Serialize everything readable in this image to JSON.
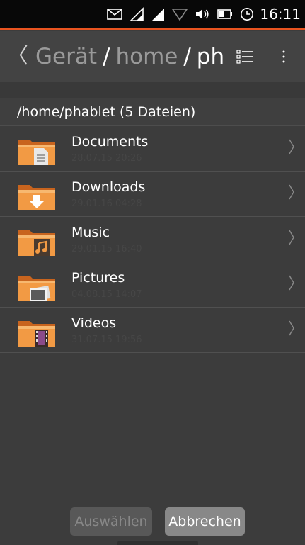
{
  "status": {
    "time": "16:11"
  },
  "header": {
    "back_glyph": "〈",
    "path": {
      "seg1": "Gerät",
      "sep1": "/",
      "seg2": "home",
      "sep2": "/",
      "seg3": "ph"
    }
  },
  "folder": {
    "title": "/home/phablet (5 Dateien)"
  },
  "items": [
    {
      "name": "Documents",
      "date": "28.07.15 20:26",
      "icon": "documents-folder-icon"
    },
    {
      "name": "Downloads",
      "date": "29.01.16 04:28",
      "icon": "downloads-folder-icon"
    },
    {
      "name": "Music",
      "date": "29.01.15 16:40",
      "icon": "music-folder-icon"
    },
    {
      "name": "Pictures",
      "date": "04.08.15 14:07",
      "icon": "pictures-folder-icon"
    },
    {
      "name": "Videos",
      "date": "31.07.15 19:56",
      "icon": "videos-folder-icon"
    }
  ],
  "buttons": {
    "select_label": "Auswählen",
    "cancel_label": "Abbrechen"
  },
  "colors": {
    "accent": "#e95420",
    "folder": "#f29a44",
    "background": "#3c3c3c"
  }
}
